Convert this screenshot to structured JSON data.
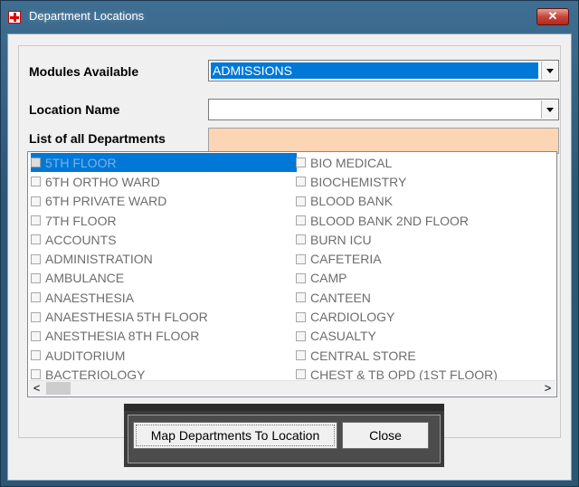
{
  "window": {
    "title": "Department Locations",
    "close_glyph": "✕",
    "icon": "red-cross-icon"
  },
  "form": {
    "modules_label": "Modules Available",
    "modules_value": "ADMISSIONS",
    "location_label": "Location Name",
    "location_value": "",
    "list_label": "List of all Departments"
  },
  "departments": {
    "col1": [
      "5TH FLOOR",
      "6TH ORTHO WARD",
      "6TH PRIVATE WARD",
      "7TH FLOOR",
      "ACCOUNTS",
      "ADMINISTRATION",
      "AMBULANCE",
      "ANAESTHESIA",
      "ANAESTHESIA 5TH FLOOR",
      "ANESTHESIA 8TH FLOOR",
      "AUDITORIUM",
      "BACTERIOLOGY"
    ],
    "col2": [
      "BIO MEDICAL",
      "BIOCHEMISTRY",
      "BLOOD BANK",
      "BLOOD BANK 2ND FLOOR",
      "BURN ICU",
      "CAFETERIA",
      "CAMP",
      "CANTEEN",
      "CARDIOLOGY",
      "CASUALTY",
      "CENTRAL STORE",
      "CHEST & TB OPD (1ST FLOOR)"
    ]
  },
  "scroll": {
    "left_glyph": "<",
    "right_glyph": ">"
  },
  "buttons": {
    "map_label": "Map Departments To Location",
    "close_label": "Close"
  },
  "colors": {
    "selection": "#0078d7",
    "peach_box": "#fcd5b4",
    "close_button": "#c8453b"
  }
}
